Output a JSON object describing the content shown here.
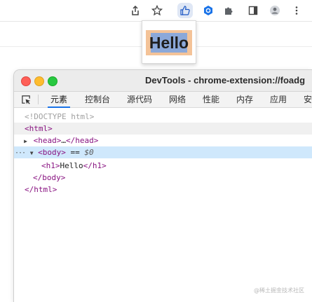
{
  "browser_toolbar": {
    "icons": [
      "share-icon",
      "star-icon",
      "thumbs-up-icon",
      "extension-icon",
      "puzzle-icon",
      "sidepanel-icon",
      "profile-icon",
      "more-icon"
    ]
  },
  "popup": {
    "heading": "Hello",
    "colors": {
      "margin": "#f4c398",
      "content": "#8ba8d9"
    }
  },
  "devtools": {
    "title": "DevTools - chrome-extension://foadg",
    "tabs": [
      "元素",
      "控制台",
      "源代码",
      "网络",
      "性能",
      "内存",
      "应用",
      "安"
    ],
    "active_tab": "元素",
    "dom": {
      "doctype": "<!DOCTYPE html>",
      "html_open": "<html>",
      "head_open": "<head>",
      "head_ellipsis": "…",
      "head_close": "</head>",
      "body_open": "<body>",
      "body_eq": " == ",
      "body_var": "$0",
      "h1_open": "<h1>",
      "h1_text": "Hello",
      "h1_close": "</h1>",
      "body_close": "</body>",
      "html_close": "</html>",
      "dots": "···"
    }
  },
  "watermark": "@稀土掘金技术社区"
}
